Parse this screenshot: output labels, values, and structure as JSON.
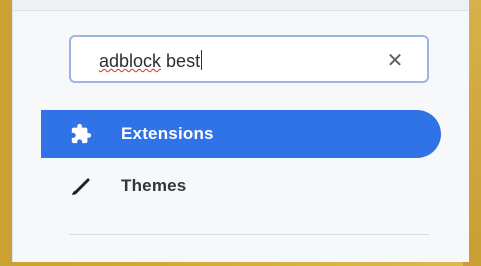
{
  "search": {
    "value_prefix": "adblock",
    "value_suffix": " best",
    "clear_glyph": "✕",
    "icon": "close-icon"
  },
  "nav": {
    "items": [
      {
        "label": "Extensions",
        "icon": "puzzle-icon",
        "active": true
      },
      {
        "label": "Themes",
        "icon": "brush-icon",
        "active": false
      }
    ]
  },
  "colors": {
    "accent": "#2f73e6",
    "panel": "#f7f8fa"
  }
}
